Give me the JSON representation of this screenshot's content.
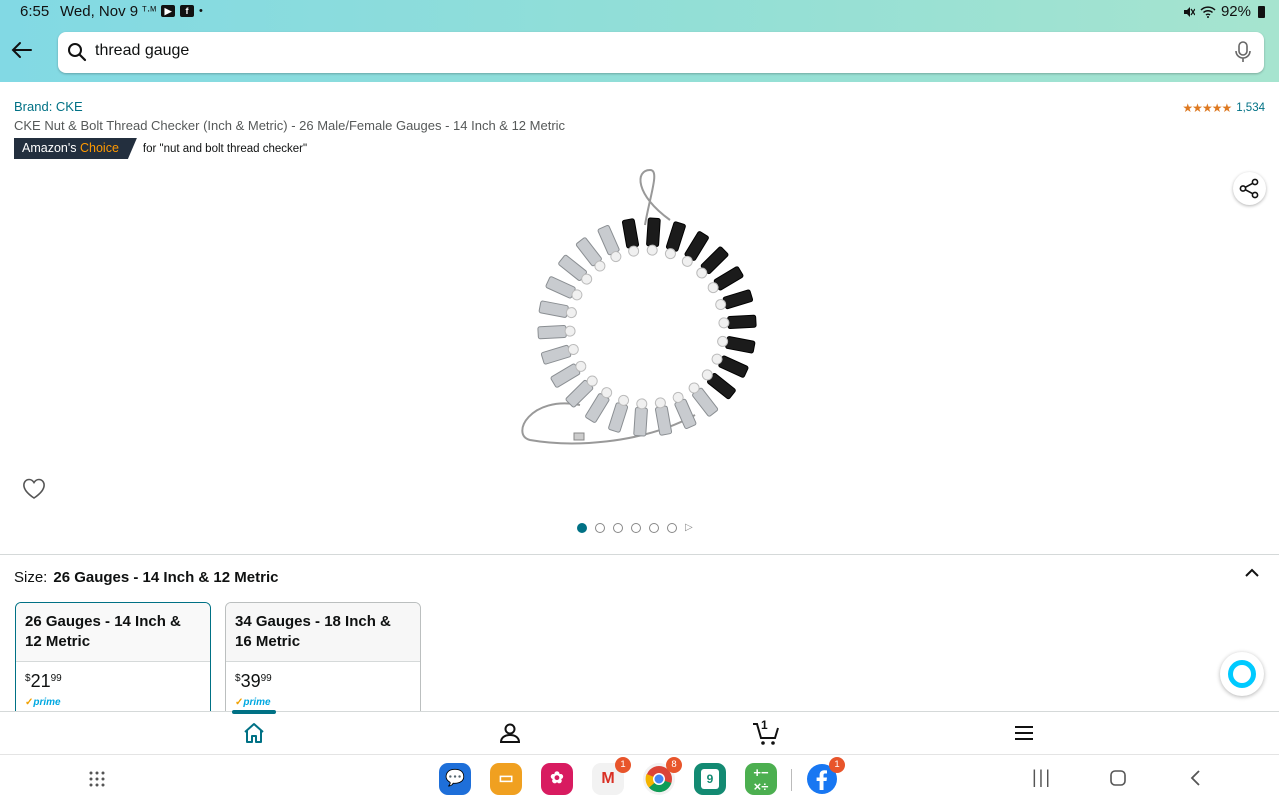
{
  "status_bar": {
    "time": "6:55",
    "date": "Wed, Nov 9",
    "battery": "92%"
  },
  "search": {
    "query": "thread gauge"
  },
  "product": {
    "brand": "Brand: CKE",
    "title": "CKE Nut & Bolt Thread Checker (Inch & Metric) - 26 Male/Female Gauges - 14 Inch & 12 Metric",
    "badge_prefix": "Amazon's",
    "badge_highlight": "Choice",
    "badge_for": "for \"nut and bolt thread checker\"",
    "rating_stars": 4.5,
    "rating_count": "1,534"
  },
  "carousel": {
    "total": 6,
    "active": 1
  },
  "size": {
    "label": "Size:",
    "selected": "26 Gauges - 14 Inch & 12 Metric",
    "options": [
      {
        "title": "26 Gauges - 14 Inch & 12 Metric",
        "price_dollars": "21",
        "price_cents": "99",
        "prime": "prime"
      },
      {
        "title": "34 Gauges - 18 Inch & 16 Metric",
        "price_dollars": "39",
        "price_cents": "99",
        "prime": "prime"
      }
    ]
  },
  "bottom_nav": {
    "cart_count": "1"
  },
  "dock": [
    {
      "name": "messages",
      "badge": ""
    },
    {
      "name": "folder",
      "badge": ""
    },
    {
      "name": "blossom",
      "badge": ""
    },
    {
      "name": "gmail",
      "badge": "1"
    },
    {
      "name": "chrome",
      "badge": "8"
    },
    {
      "name": "calendar",
      "label": "9",
      "badge": ""
    },
    {
      "name": "calculator",
      "badge": ""
    },
    {
      "name": "facebook",
      "badge": "1"
    }
  ],
  "colors": {
    "accent": "#007185",
    "stars": "#de7921",
    "nav_dark": "#232f3e",
    "choice_orange": "#ff9900"
  }
}
